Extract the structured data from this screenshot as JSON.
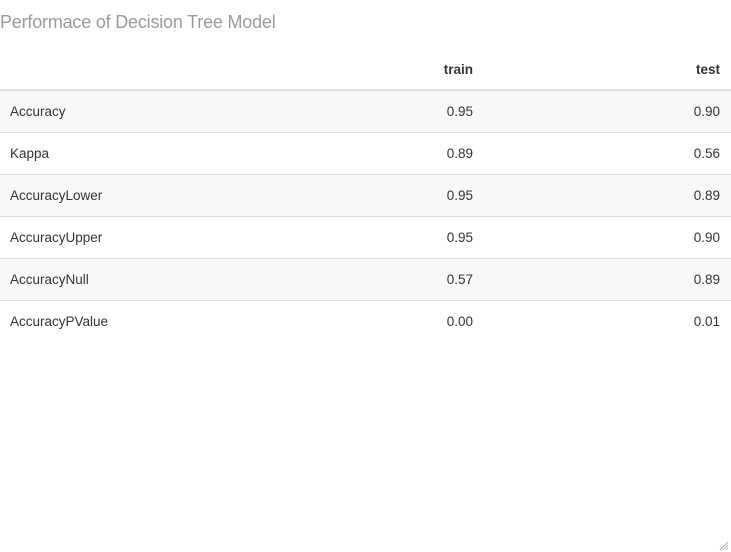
{
  "caption": "Performace of Decision Tree Model",
  "columns": [
    "",
    "train",
    "test"
  ],
  "rows": [
    {
      "label": "Accuracy",
      "train": "0.95",
      "test": "0.90"
    },
    {
      "label": "Kappa",
      "train": "0.89",
      "test": "0.56"
    },
    {
      "label": "AccuracyLower",
      "train": "0.95",
      "test": "0.89"
    },
    {
      "label": "AccuracyUpper",
      "train": "0.95",
      "test": "0.90"
    },
    {
      "label": "AccuracyNull",
      "train": "0.57",
      "test": "0.89"
    },
    {
      "label": "AccuracyPValue",
      "train": "0.00",
      "test": "0.01"
    }
  ],
  "icons": {
    "resize_grip": "resize-grip-icon"
  }
}
